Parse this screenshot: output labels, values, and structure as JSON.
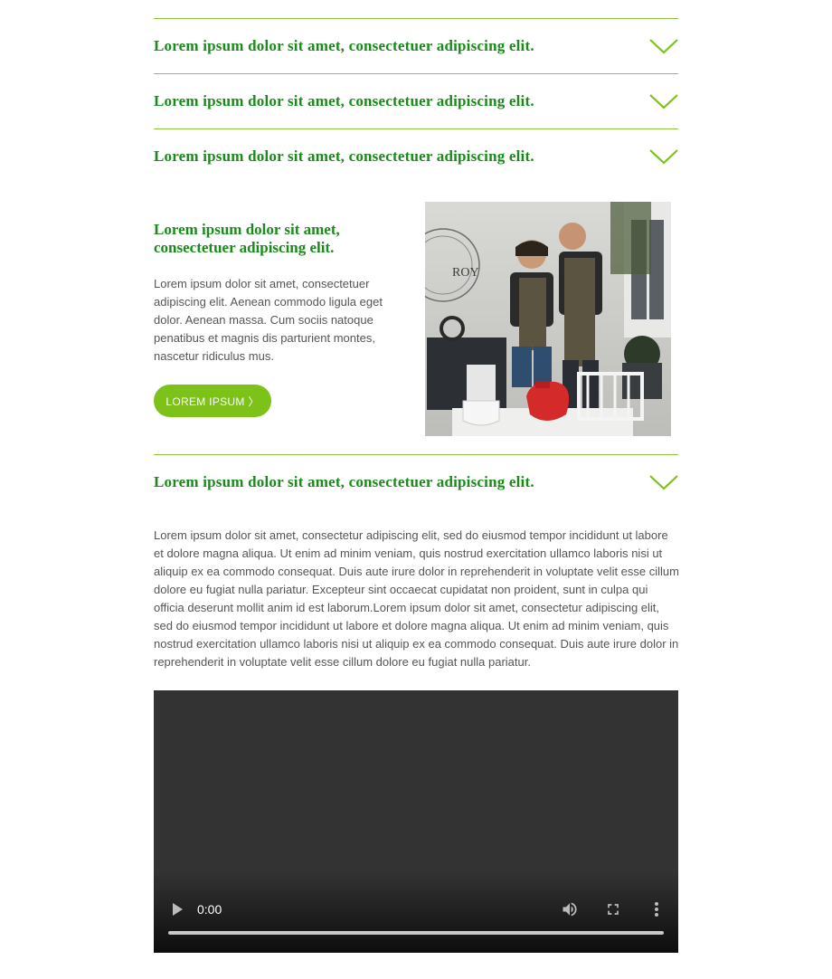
{
  "accordion": [
    {
      "title": "Lorem ipsum dolor sit amet, consectetuer adipiscing elit."
    },
    {
      "title": "Lorem ipsum dolor sit amet, consectetuer adipiscing elit."
    },
    {
      "title": "Lorem ipsum dolor sit amet, consectetuer adipiscing elit."
    },
    {
      "title": "Lorem ipsum dolor sit amet, consectetuer adipiscing elit."
    }
  ],
  "feature": {
    "heading": "Lorem ipsum dolor sit amet, consectetuer adipiscing elit.",
    "body": "Lorem ipsum dolor sit amet, consectetuer adipiscing elit. Aenean commodo ligula eget dolor. Aenean massa. Cum sociis natoque penatibus et magnis dis parturient montes, nascetur ridiculus mus.",
    "button_label": "LOREM IPSUM 〉",
    "photo_sign_text": "ROY"
  },
  "long_text": "Lorem ipsum dolor sit amet, consectetur adipiscing elit, sed do eiusmod tempor incididunt ut labore et dolore magna aliqua. Ut enim ad minim veniam, quis nostrud exercitation ullamco laboris nisi ut aliquip ex ea commodo consequat. Duis aute irure dolor in reprehenderit in voluptate velit esse cillum dolore eu fugiat nulla pariatur. Excepteur sint occaecat cupidatat non proident, sunt in culpa qui officia deserunt mollit anim id est laborum.Lorem ipsum dolor sit amet, consectetur adipiscing elit, sed do eiusmod tempor incididunt ut labore et dolore magna aliqua. Ut enim ad minim veniam, quis nostrud exercitation ullamco laboris nisi ut aliquip ex ea commodo consequat. Duis aute irure dolor in reprehenderit in voluptate velit esse cillum dolore eu fugiat nulla pariatur.",
  "video": {
    "time": "0:00",
    "progress": 0
  },
  "colors": {
    "accent_green": "#1a8a1a",
    "button_green": "#7cc218",
    "divider_green": "#8cc63f",
    "body_text": "#555555"
  },
  "icons": [
    "chevron-down-icon",
    "play-icon",
    "volume-icon",
    "fullscreen-icon",
    "more-vert-icon"
  ]
}
